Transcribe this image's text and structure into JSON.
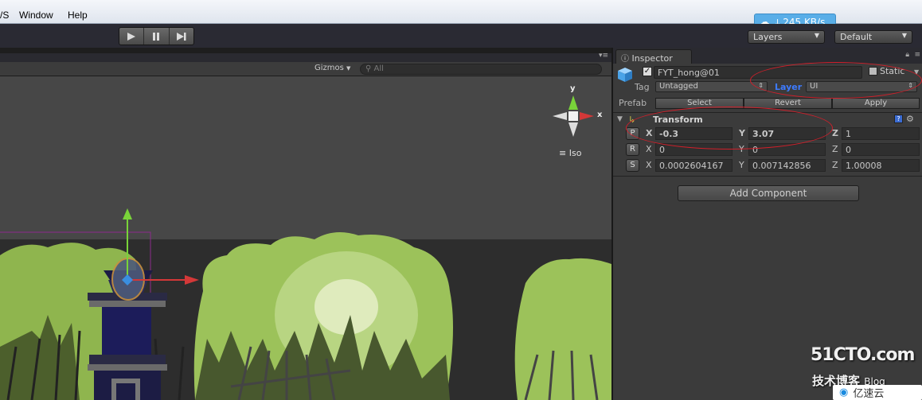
{
  "menu": {
    "items": [
      "/S",
      "Window",
      "Help"
    ]
  },
  "toolbar": {
    "layers_label": "Layers",
    "layout_label": "Default"
  },
  "download_speed": "245 KB/s",
  "scene": {
    "gizmos_label": "Gizmos",
    "search_placeholder": "All",
    "iso_label": "Iso",
    "axis_y": "y",
    "axis_x": "x"
  },
  "inspector": {
    "tab_label": "Inspector",
    "object_name": "FYT_hong@01",
    "static_label": "Static",
    "tag_label": "Tag",
    "tag_value": "Untagged",
    "layer_label": "Layer",
    "layer_value": "UI",
    "prefab_label": "Prefab",
    "prefab_select": "Select",
    "prefab_revert": "Revert",
    "prefab_apply": "Apply",
    "transform_title": "Transform",
    "position": {
      "button": "P",
      "x": "-0.3",
      "y": "3.07",
      "z": "1"
    },
    "rotation": {
      "button": "R",
      "x": "0",
      "y": "0",
      "z": "0"
    },
    "scale": {
      "button": "S",
      "x": "0.0002604167",
      "y": "0.007142856",
      "z": "1.00008"
    },
    "add_component": "Add Component"
  },
  "watermark": {
    "line1": "51CTO.com",
    "line2": "技术博客",
    "line2_suffix": "Blog",
    "logo_text": "亿速云"
  },
  "colors": {
    "annotation_red": "#d21f2a",
    "speed_badge": "#59aee8",
    "grass_green": "#9cc25a"
  }
}
